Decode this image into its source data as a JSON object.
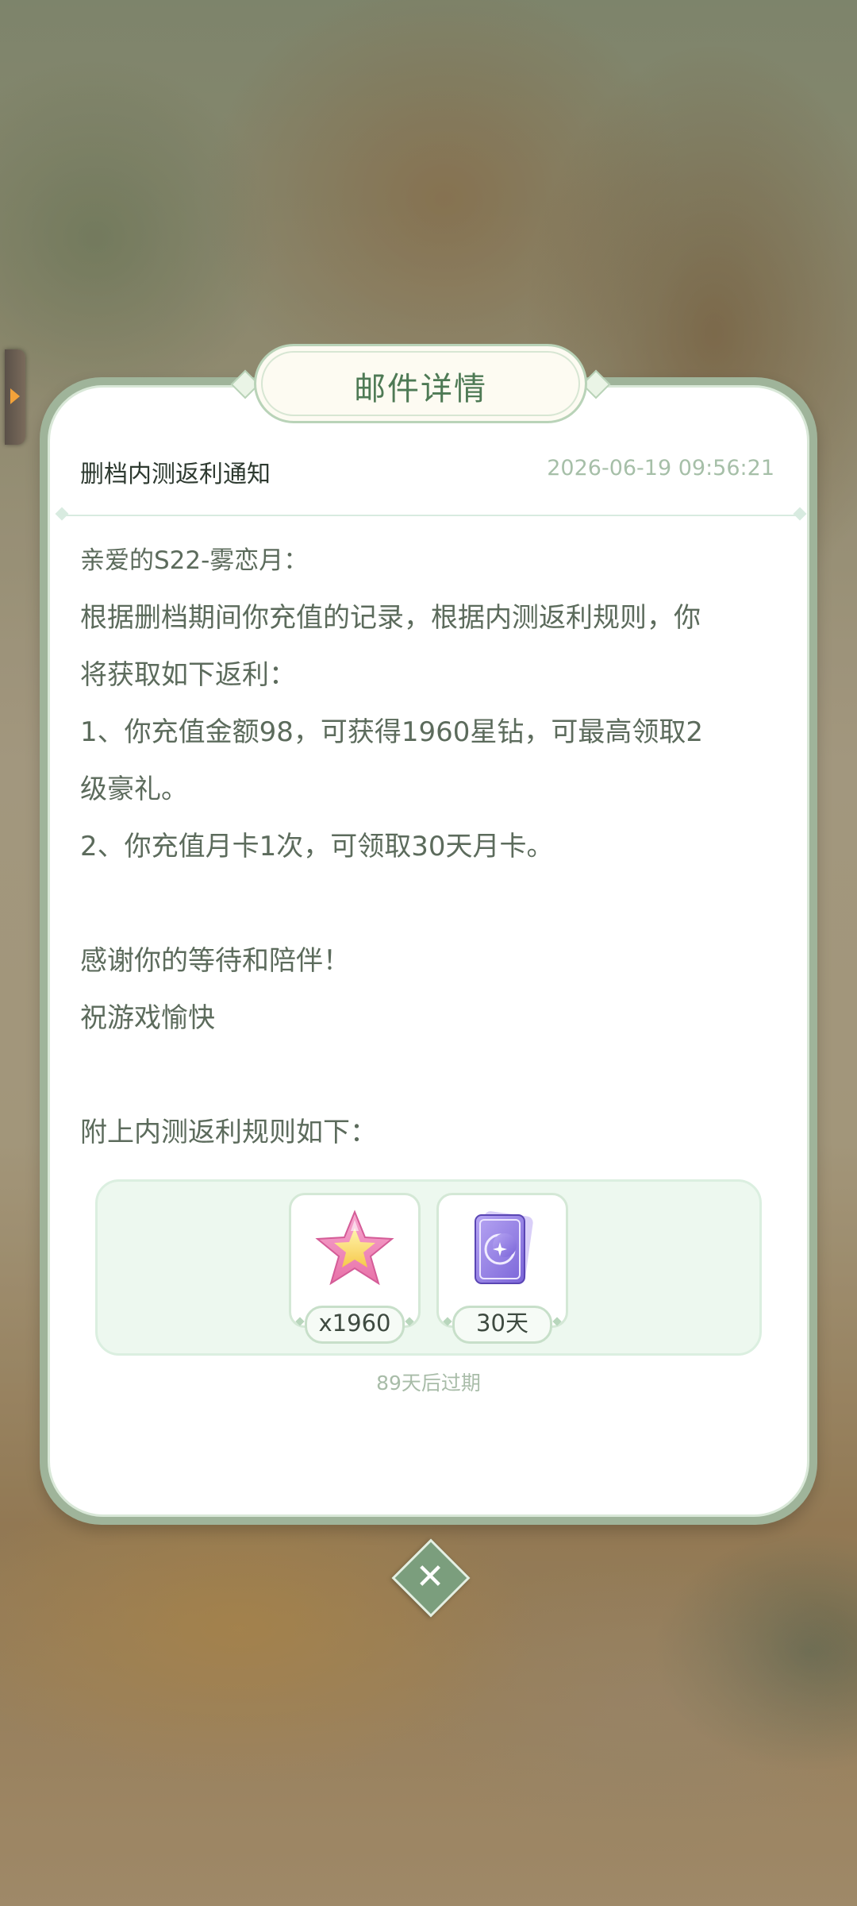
{
  "header": {
    "title": "邮件详情"
  },
  "mail": {
    "subject": "删档内测返利通知",
    "date": "2026-06-19 09:56:21",
    "body": {
      "greeting": "亲爱的S22-雾恋月：",
      "line1": "根据删档期间你充值的记录，根据内测返利规则，你",
      "line2": "将获取如下返利：",
      "line3": "1、你充值金额98，可获得1960星钻，可最高领取2",
      "line4": "级豪礼。",
      "line5": "2、你充值月卡1次，可领取30天月卡。",
      "line6": "感谢你的等待和陪伴！",
      "line7": "祝游戏愉快",
      "line8": "附上内测返利规则如下："
    }
  },
  "attachments": [
    {
      "icon": "star-diamond-icon",
      "quantity": "x1960"
    },
    {
      "icon": "moon-card-icon",
      "quantity": "30天"
    }
  ],
  "expire_text": "89天后过期",
  "colors": {
    "title_green": "#4e7a55",
    "panel_frame": "#9fb49a",
    "attach_bg": "#edf8ef",
    "close_button": "#7b9e7d"
  }
}
